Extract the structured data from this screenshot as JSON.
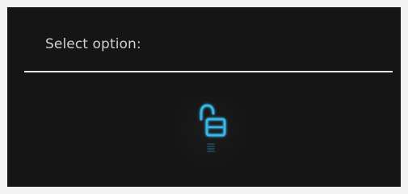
{
  "dialog": {
    "title": "Select option:"
  },
  "option": {
    "icon": "unlocked-padlock-icon",
    "sub_icon": "menu-lines-icon",
    "accent_color": "#39b7e7"
  }
}
